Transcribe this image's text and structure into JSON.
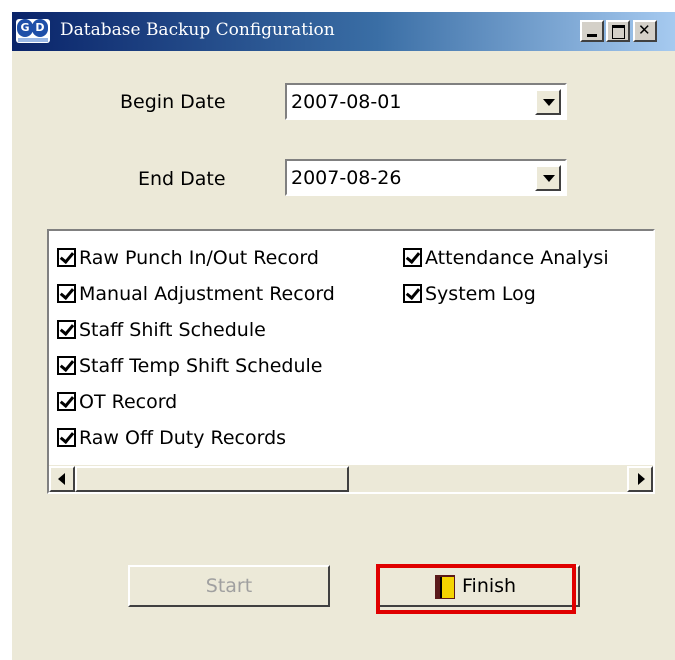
{
  "window": {
    "title": "Database Backup Configuration",
    "app_icon_text": "GD",
    "controls": [
      "minimize-icon",
      "maximize-icon",
      "close-icon"
    ]
  },
  "form": {
    "begin_label": "Begin Date",
    "begin_value": "2007-08-01",
    "end_label": "End Date",
    "end_value": "2007-08-26"
  },
  "backup_items": [
    {
      "label": "Raw Punch In/Out Record",
      "checked": true
    },
    {
      "label": "Manual Adjustment Record",
      "checked": true
    },
    {
      "label": "Staff Shift Schedule",
      "checked": true
    },
    {
      "label": "Staff Temp Shift Schedule",
      "checked": true
    },
    {
      "label": "OT Record",
      "checked": true
    },
    {
      "label": "Raw Off Duty Records",
      "checked": true
    },
    {
      "label": "Attendance Analysi",
      "checked": true
    },
    {
      "label": "System Log",
      "checked": true
    }
  ],
  "buttons": {
    "start_label": "Start",
    "finish_label": "Finish"
  },
  "colors": {
    "highlight": "#e00000",
    "title_bar": "#0a246a",
    "disabled_text": "#a0a0a0"
  }
}
